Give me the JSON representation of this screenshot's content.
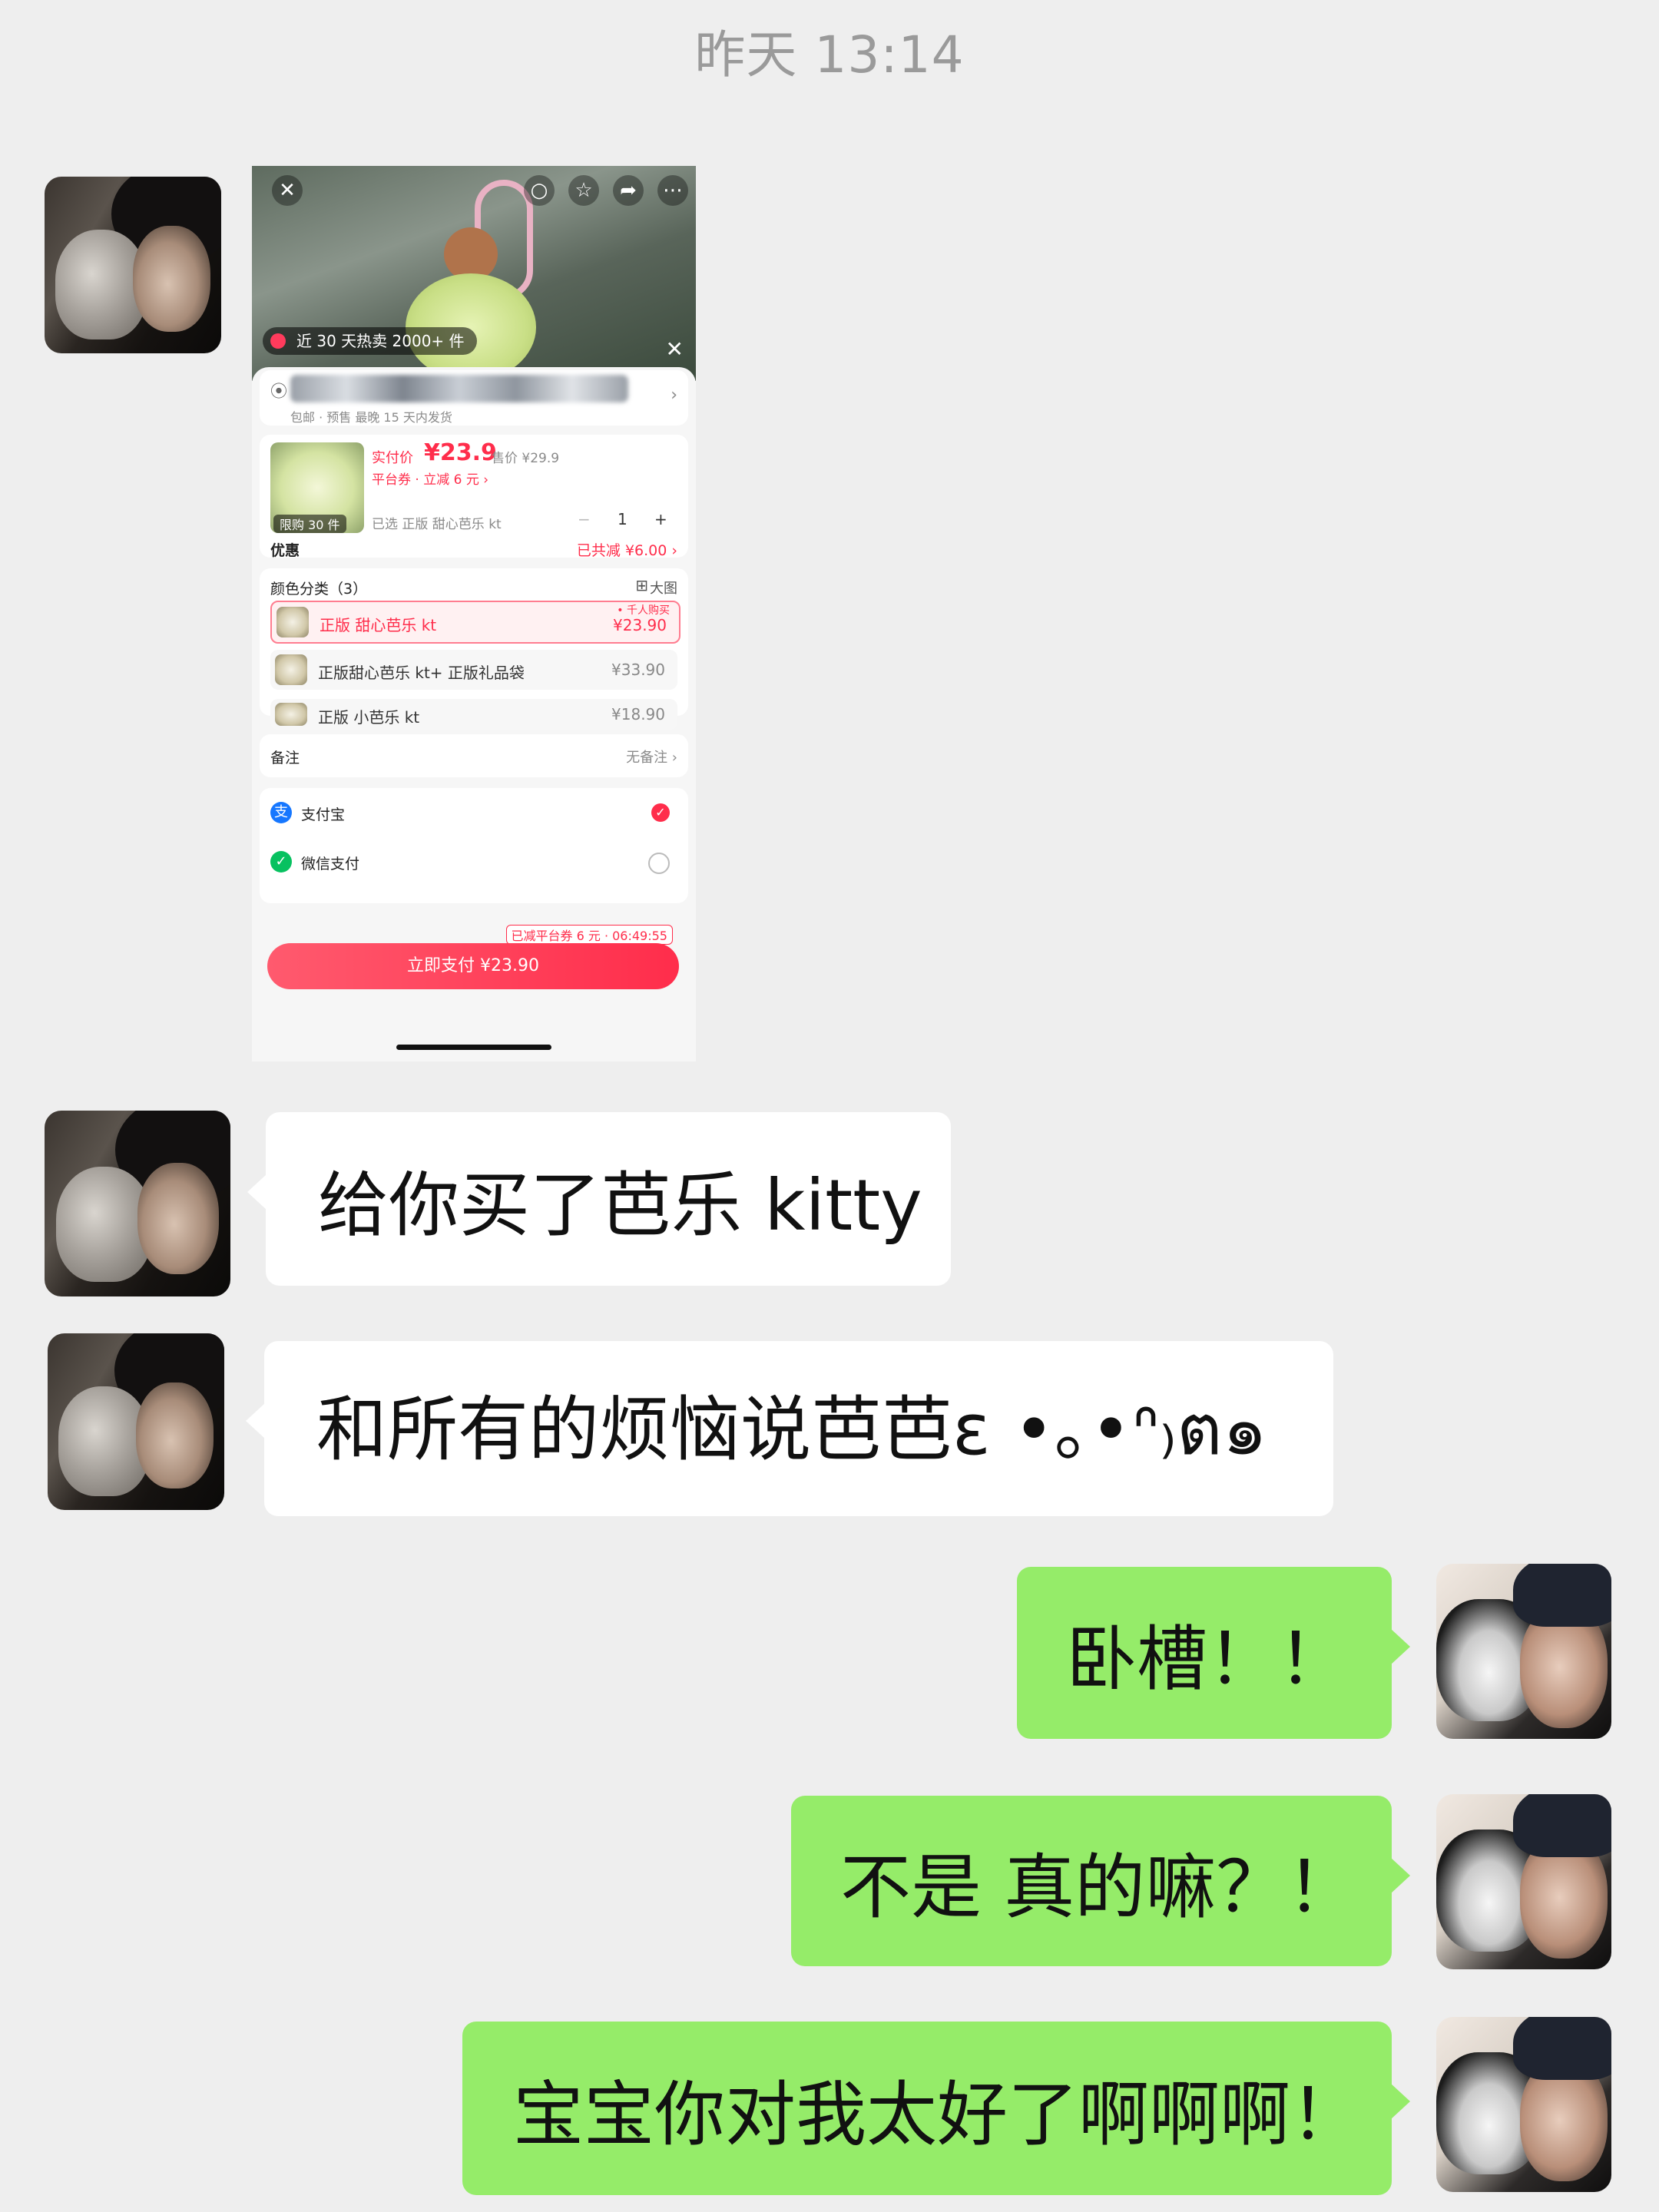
{
  "timestamp": "昨天 13:14",
  "shared_screenshot": {
    "sold_badge": "近 30 天热卖 2000+ 件",
    "shipping_note": "包邮 · 预售 最晚 15 天内发货",
    "pay_label": "实付价",
    "price": "¥23.9",
    "original_price": "售价 ¥29.9",
    "coupon_line": "平台券 · 立减 6 元 ›",
    "limit_badge": "限购 30 件",
    "selected_variant": "已选 正版 甜心芭乐 kt",
    "quantity": "1",
    "discount_label": "优惠",
    "discount_value": "已共减 ¥6.00 ›",
    "color_header": "颜色分类（3）",
    "big_image_label": "大图",
    "variants": [
      {
        "label": "正版 甜心芭乐 kt",
        "price": "¥23.90",
        "tag": "• 千人购买"
      },
      {
        "label": "正版甜心芭乐 kt+ 正版礼品袋",
        "price": "¥33.90"
      },
      {
        "label": "正版 小芭乐 kt",
        "price": "¥18.90"
      }
    ],
    "remark_label": "备注",
    "remark_value": "无备注 ›",
    "payment_methods": [
      "支付宝",
      "微信支付"
    ],
    "countdown_note": "已减平台券 6 元 · 06:49:55",
    "pay_button": "立即支付 ¥23.90"
  },
  "messages": [
    {
      "side": "left",
      "text": "给你买了芭乐 kitty"
    },
    {
      "side": "left",
      "text": "和所有的烦恼说芭芭ε  •｡•ᐢ₎ต๑"
    },
    {
      "side": "right",
      "text": "卧槽！！"
    },
    {
      "side": "right",
      "text": "不是 真的嘛？！"
    },
    {
      "side": "right",
      "text": "宝宝你对我太好了啊啊啊！"
    }
  ],
  "colors": {
    "background": "#eeeeee",
    "right_bubble": "#95ec69",
    "left_bubble": "#ffffff",
    "accent_red": "#ff2d4b"
  }
}
